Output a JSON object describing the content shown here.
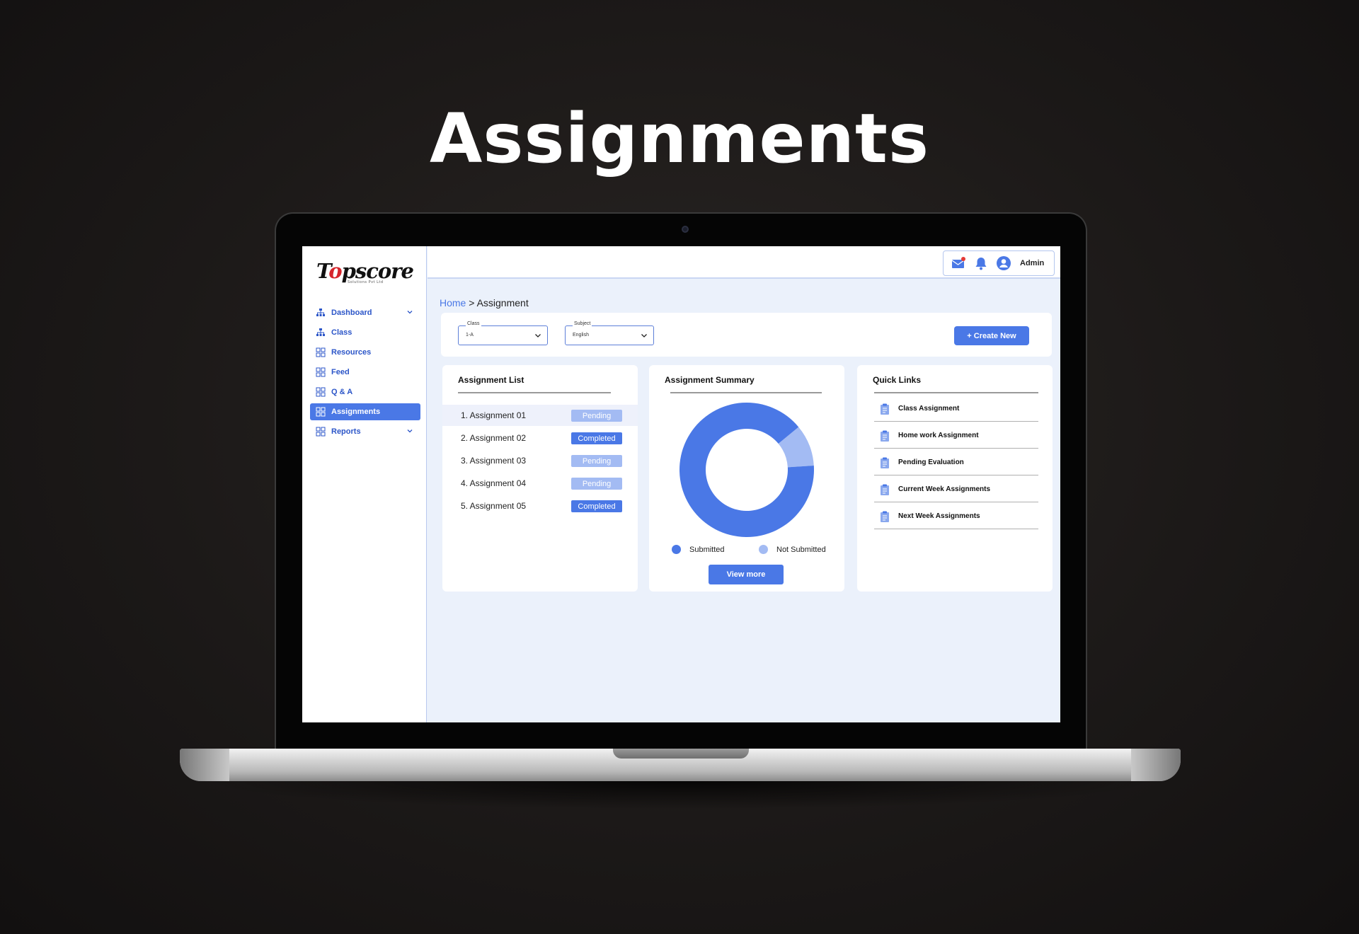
{
  "hero": {
    "title": "Assignments"
  },
  "logo": {
    "word_pre": "T",
    "word_o": "o",
    "word_post": "pscore",
    "sub": "Solutions Pvt Ltd"
  },
  "sidebar": {
    "items": [
      {
        "label": "Dashboard",
        "icon": "org-chart-icon",
        "has_chevron": true
      },
      {
        "label": "Class",
        "icon": "org-chart-icon"
      },
      {
        "label": "Resources",
        "icon": "grid-icon"
      },
      {
        "label": "Feed",
        "icon": "grid-icon"
      },
      {
        "label": "Q & A",
        "icon": "grid-icon"
      },
      {
        "label": "Assignments",
        "icon": "grid-icon",
        "active": true
      },
      {
        "label": "Reports",
        "icon": "grid-icon",
        "has_chevron": true
      }
    ]
  },
  "topbar": {
    "user": "Admin",
    "icons": [
      "mail-icon",
      "bell-icon",
      "user-avatar-icon"
    ]
  },
  "breadcrumb": {
    "home": "Home",
    "separator": ">",
    "current": "Assignment"
  },
  "filters": {
    "class": {
      "label": "Class",
      "value": "1-A"
    },
    "subject": {
      "label": "Subject",
      "value": "English"
    },
    "create": "+ Create New"
  },
  "assignment_list": {
    "title": "Assignment List",
    "rows": [
      {
        "name": "1. Assignment 01",
        "status": "Pending"
      },
      {
        "name": "2. Assignment 02",
        "status": "Completed"
      },
      {
        "name": "3. Assignment 03",
        "status": "Pending"
      },
      {
        "name": "4. Assignment 04",
        "status": "Pending"
      },
      {
        "name": "5. Assignment 05",
        "status": "Completed"
      }
    ]
  },
  "summary": {
    "title": "Assignment Summary",
    "legend": {
      "submitted": "Submitted",
      "not_submitted": "Not Submitted"
    },
    "view_more": "View more"
  },
  "chart_data": {
    "type": "pie",
    "categories": [
      "Submitted",
      "Not Submitted"
    ],
    "values": [
      90,
      10
    ],
    "colors": [
      "#4a78e6",
      "#a3bbf3"
    ]
  },
  "quick_links": {
    "title": "Quick Links",
    "items": [
      "Class Assignment",
      "Home work Assignment",
      "Pending Evaluation",
      "Current Week Assignments",
      "Next Week Assignments"
    ]
  },
  "colors": {
    "accent": "#4a78e6",
    "accent_light": "#a3bbf3",
    "screen_bg": "#ebf1fb"
  }
}
